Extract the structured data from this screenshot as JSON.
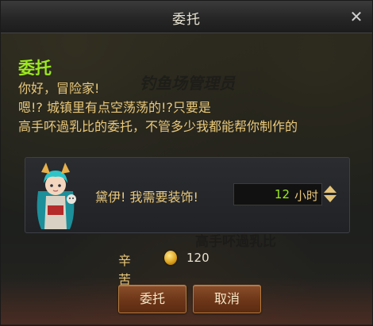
{
  "dialog": {
    "title": "委托",
    "close_glyph": "✕"
  },
  "npc": {
    "name": "委托",
    "lines": [
      "你好，冒险家!",
      "嗯!? 城镇里有点空荡荡的!?只要是",
      "高手吥過乳比的委托，不管多少我都能帮你制作的"
    ]
  },
  "background": {
    "sign_top": "钓鱼场管理员",
    "sign_mid": "高手吥過乳比"
  },
  "request": {
    "text": "黛伊! 我需要装饰!",
    "time_value": "12",
    "time_unit": "小时"
  },
  "fee": {
    "label": "辛苦费",
    "amount": "120",
    "icon": "gold-coin-icon"
  },
  "buttons": {
    "confirm": "委托",
    "cancel": "取消"
  },
  "colors": {
    "accent_green": "#9be81f",
    "text_gold": "#e9c87a",
    "button_brown": "#6d3618"
  }
}
